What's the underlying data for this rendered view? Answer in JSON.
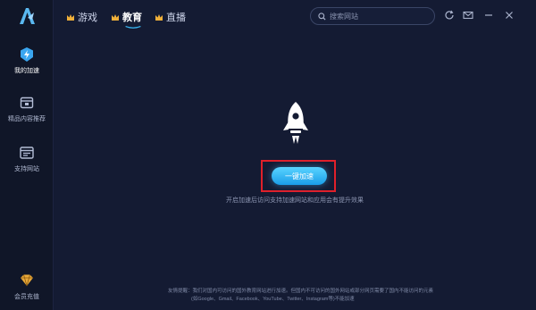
{
  "colors": {
    "background": "#141b33",
    "sidebar": "#101628",
    "accent": "#3ab8f5",
    "crown": "#f0b03a",
    "highlight_box": "#e0202a"
  },
  "app": {
    "logo_icon": "logo-icon"
  },
  "sidebar": {
    "items": [
      {
        "label": "我的加速",
        "icon": "bolt-shield-icon",
        "active": true
      },
      {
        "label": "精品内容推荐",
        "icon": "box-icon",
        "active": false
      },
      {
        "label": "支持网站",
        "icon": "browser-window-icon",
        "active": false
      }
    ],
    "member": {
      "label": "会员充值",
      "icon": "diamond-icon"
    }
  },
  "topbar": {
    "tabs": [
      {
        "label": "游戏",
        "active": false
      },
      {
        "label": "教育",
        "active": true
      },
      {
        "label": "直播",
        "active": false
      }
    ],
    "search": {
      "placeholder": "搜索网站",
      "value": ""
    },
    "tools": [
      "refresh-icon",
      "mail-icon",
      "minimize-icon",
      "close-icon"
    ]
  },
  "main": {
    "button_label": "一键加速",
    "tip": "开启加速后访问支持加速网站和应用会有提升效果",
    "notice": [
      "友情提醒：我们对国内可访问的国外教育网站进行加速。但国内不可访问的国外网站或部分网页需要了国内不能访问的元素",
      "(如Google、Gmail、Facebook、YouTube、Twitter、Instagram等)不能加速"
    ]
  }
}
